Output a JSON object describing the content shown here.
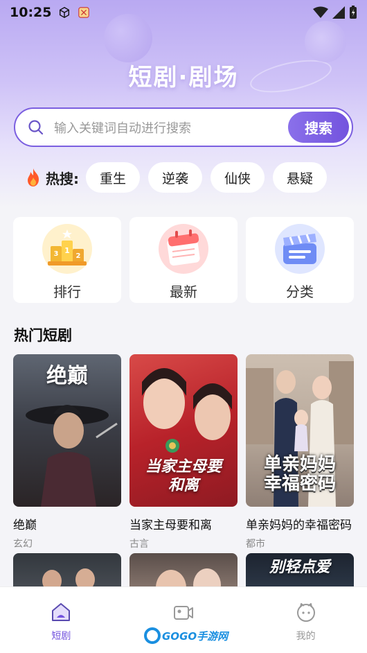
{
  "status_bar": {
    "time": "10:25"
  },
  "header": {
    "title": "短剧·剧场"
  },
  "search": {
    "placeholder": "输入关键词自动进行搜索",
    "button_label": "搜索"
  },
  "hot_search": {
    "label": "热搜:",
    "tags": [
      "重生",
      "逆袭",
      "仙侠",
      "悬疑"
    ]
  },
  "categories": [
    {
      "label": "排行",
      "icon": "podium-icon"
    },
    {
      "label": "最新",
      "icon": "calendar-icon"
    },
    {
      "label": "分类",
      "icon": "clapperboard-icon"
    }
  ],
  "hot_dramas": {
    "title": "热门短剧",
    "items": [
      {
        "name": "绝巅",
        "genre": "玄幻",
        "poster_text": "绝巅"
      },
      {
        "name": "当家主母要和离",
        "genre": "古言",
        "poster_text": "当家主母要和离"
      },
      {
        "name": "单亲妈妈的幸福密码",
        "genre": "都市",
        "poster_text": "单亲妈妈幸福密码"
      }
    ],
    "next_row": [
      {
        "poster_text": ""
      },
      {
        "poster_text": ""
      },
      {
        "poster_text": "别轻点爱"
      }
    ]
  },
  "tabbar": {
    "tabs": [
      {
        "label": "短剧",
        "active": true
      },
      {
        "label": "",
        "active": false
      },
      {
        "label": "我的",
        "active": false
      }
    ]
  },
  "watermark": {
    "text": "GOGO手游网"
  },
  "colors": {
    "accent": "#7353de",
    "background": "#f4f4f8"
  }
}
